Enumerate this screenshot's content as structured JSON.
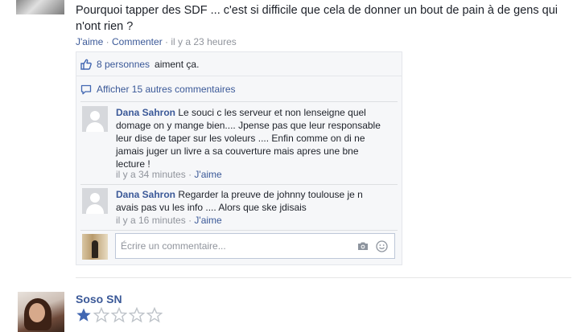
{
  "post": {
    "text": "Pourquoi tapper des SDF ... c'est si difficile que cela de donner un bout de pain à de gens qui n'ont rien ?",
    "like_label": "J'aime",
    "comment_label": "Commenter",
    "timestamp": "il y a 23 heures",
    "separator": "·"
  },
  "likes": {
    "count_label": "8 personnes",
    "suffix": "aiment ça."
  },
  "more_comments": {
    "label": "Afficher 15 autres commentaires"
  },
  "comments": [
    {
      "author": "Dana Sahron",
      "text": "Le souci c les serveur et non lenseigne quel domage on y mange bien.... Jpense pas que leur responsable leur dise de taper sur les voleurs .... Enfin comme on di ne jamais juger un livre a sa couverture mais apres une bne lecture !",
      "timestamp": "il y a 34 minutes",
      "like_label": "J'aime"
    },
    {
      "author": "Dana Sahron",
      "text": "Regarder la preuve de johnny toulouse je n avais pas vu les info .... Alors que ske jdisais",
      "timestamp": "il y a 16 minutes",
      "like_label": "J'aime"
    }
  ],
  "composer": {
    "placeholder": "Écrire un commentaire..."
  },
  "next_post": {
    "author": "Soso SN",
    "rating": 1,
    "rating_max": 5
  },
  "colors": {
    "link": "#3b5998",
    "meta": "#90949c",
    "star_filled": "#4267b2",
    "star_empty": "#bec3c9"
  }
}
